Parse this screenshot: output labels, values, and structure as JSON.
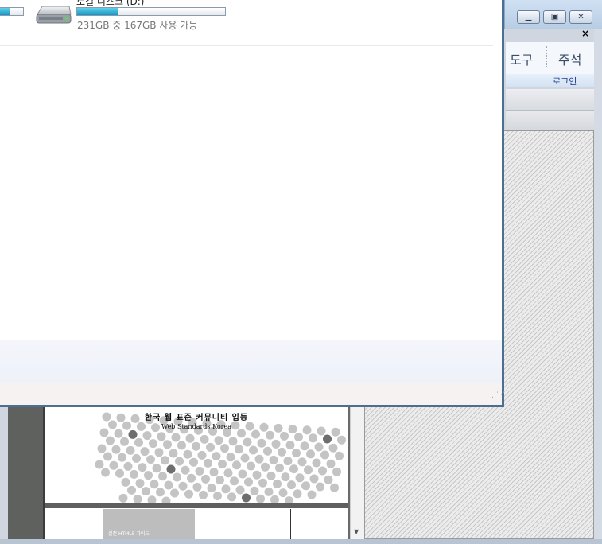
{
  "explorer": {
    "drive": {
      "name": "로컬 디스크 (D:)",
      "space_text": "231GB 중 167GB 사용 가능",
      "used_fraction": 0.28
    },
    "left_drive": {
      "used_fraction": 0.4
    }
  },
  "background_app": {
    "close_glyph": "×",
    "tabs": [
      "도구",
      "주석"
    ],
    "login_label": "로그인",
    "window_controls": [
      "minimize-icon",
      "maximize-icon",
      "close-icon"
    ]
  },
  "web_preview": {
    "site_title": "한국 웹 표준 커뮤니티 입등",
    "site_subtitle": "Web Standards Korea",
    "card_text": "실전 HTML5 가이드"
  },
  "colors": {
    "window_border": "#4d6e93",
    "progress_fill": "#1595c1",
    "dot_color": "#c4c4c4",
    "dark_dot": "#6e6e6e"
  }
}
